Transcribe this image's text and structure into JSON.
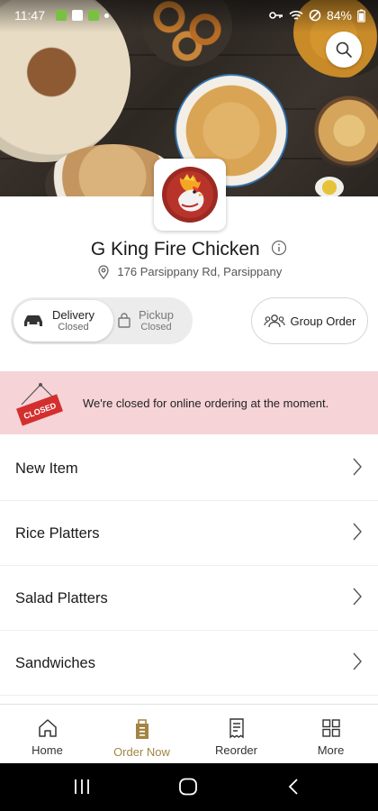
{
  "status_bar": {
    "time": "11:47",
    "battery": "84%"
  },
  "restaurant": {
    "name": "G King Fire Chicken",
    "address": "176 Parsippany Rd, Parsippany"
  },
  "order_mode": {
    "delivery": {
      "label": "Delivery",
      "status": "Closed",
      "selected": true
    },
    "pickup": {
      "label": "Pickup",
      "status": "Closed",
      "selected": false
    }
  },
  "group_order_label": "Group Order",
  "closed_banner": {
    "sign_text": "CLOSED",
    "message": "We're closed for online ordering at the moment."
  },
  "menu_categories": [
    "New Item",
    "Rice Platters",
    "Salad Platters",
    "Sandwiches"
  ],
  "bottom_nav": [
    {
      "label": "Home",
      "icon": "home-icon"
    },
    {
      "label": "Order Now",
      "icon": "bag-icon",
      "active": true
    },
    {
      "label": "Reorder",
      "icon": "receipt-icon"
    },
    {
      "label": "More",
      "icon": "grid-icon"
    }
  ],
  "colors": {
    "accent": "#a48443",
    "banner": "#f6d3d7",
    "closed_sign": "#d32f2f"
  }
}
